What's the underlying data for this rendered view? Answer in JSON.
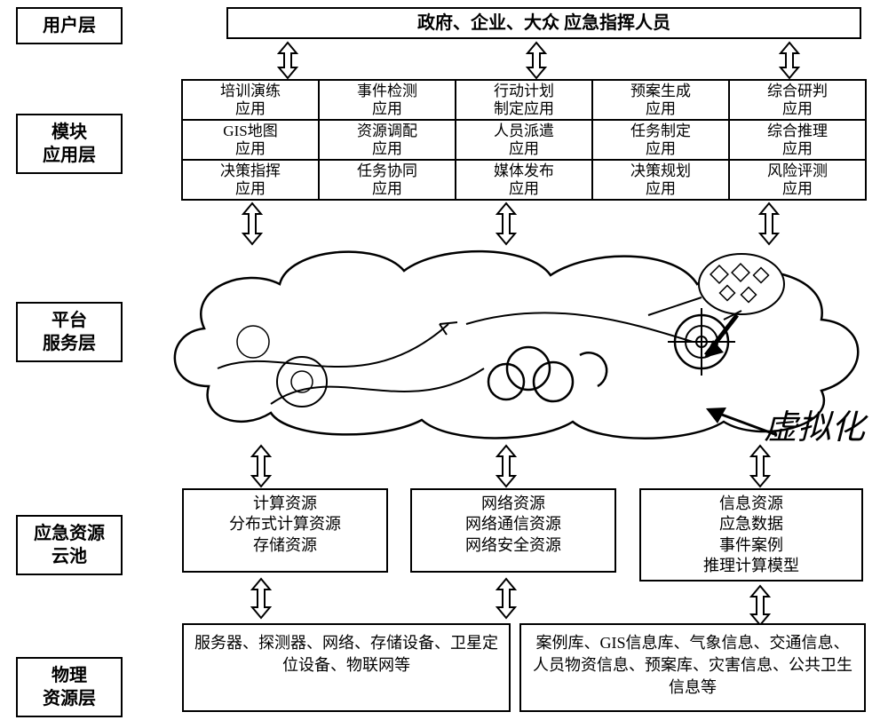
{
  "layers": {
    "user": "用户层",
    "module": "模块\n应用层",
    "platform": "平台\n服务层",
    "resource": "应急资源\n云池",
    "physical": "物理\n资源层"
  },
  "user_bar": "政府、企业、大众 应急指挥人员",
  "modules": [
    "培训演练\n应用",
    "事件检测\n应用",
    "行动计划\n制定应用",
    "预案生成\n应用",
    "综合研判\n应用",
    "GIS地图\n应用",
    "资源调配\n应用",
    "人员派遣\n应用",
    "任务制定\n应用",
    "综合推理\n应用",
    "决策指挥\n应用",
    "任务协同\n应用",
    "媒体发布\n应用",
    "决策规划\n应用",
    "风险评测\n应用"
  ],
  "virtualization": "虚拟化",
  "resources": {
    "r1": "计算资源\n分布式计算资源\n存储资源",
    "r2": "网络资源\n网络通信资源\n网络安全资源",
    "r3": "信息资源\n应急数据\n事件案例\n推理计算模型"
  },
  "physical": {
    "p1": "服务器、探测器、网络、存储设备、卫星定位设备、物联网等",
    "p2": "案例库、GIS信息库、气象信息、交通信息、人员物资信息、预案库、灾害信息、公共卫生信息等"
  }
}
